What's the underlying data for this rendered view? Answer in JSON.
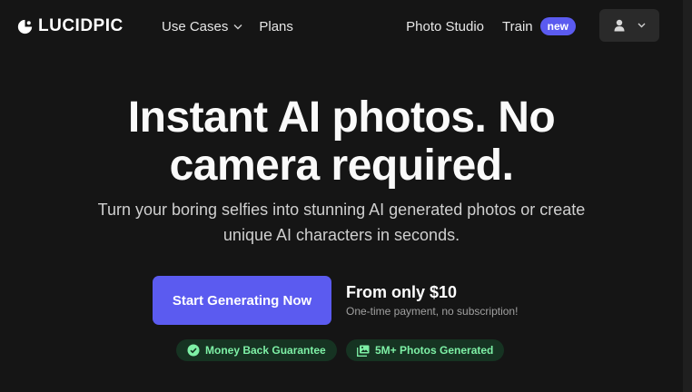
{
  "header": {
    "logo_text": "LUCIDPIC",
    "nav_left": [
      {
        "label": "Use Cases",
        "has_dropdown": true,
        "icon": "chevron-down-icon"
      },
      {
        "label": "Plans"
      }
    ],
    "nav_right": {
      "photo_studio": "Photo Studio",
      "train": "Train",
      "train_badge": "new"
    },
    "user_menu": {
      "icon": "user-icon",
      "dropdown_icon": "chevron-down-icon"
    }
  },
  "hero": {
    "title_line1": "Instant AI photos. No",
    "title_line2": "camera required.",
    "subtitle_line1": "Turn your boring selfies into stunning AI generated photos or create",
    "subtitle_line2": "unique AI characters in seconds.",
    "cta_label": "Start Generating Now",
    "price_main": "From only $10",
    "price_note": "One-time payment, no subscription!",
    "badges": [
      {
        "label": "Money Back Guarantee",
        "icon": "check-badge-icon"
      },
      {
        "label": "5M+ Photos Generated",
        "icon": "photos-icon"
      }
    ]
  },
  "colors": {
    "background": "#151515",
    "accent": "#5b5bf0",
    "badge_bg": "#163322",
    "badge_text": "#7ef0a6"
  }
}
